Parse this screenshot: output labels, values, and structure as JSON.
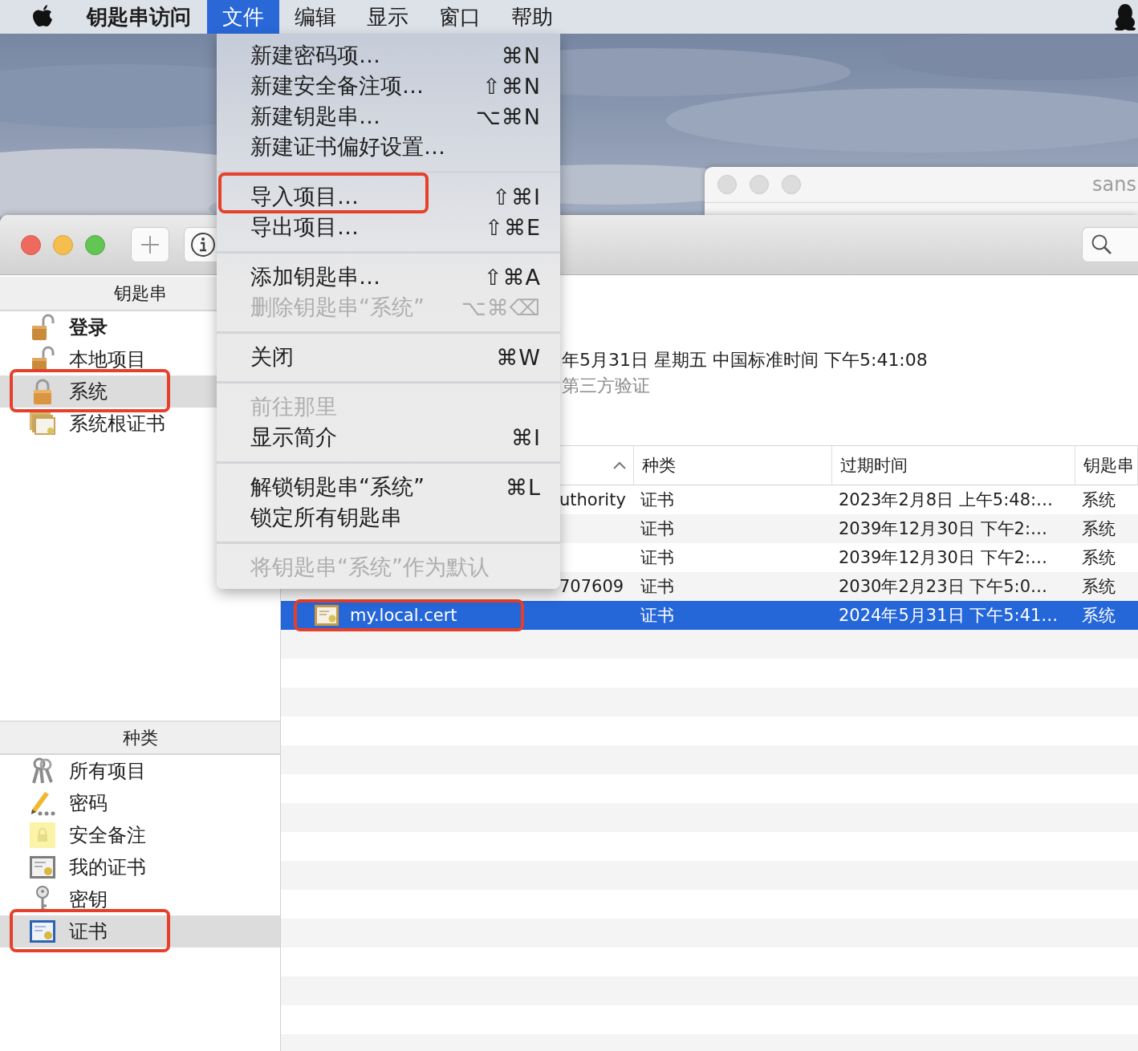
{
  "menubar": {
    "app_name": "钥匙串访问",
    "menus": [
      {
        "label": "文件",
        "selected": true
      },
      {
        "label": "编辑",
        "selected": false
      },
      {
        "label": "显示",
        "selected": false
      },
      {
        "label": "窗口",
        "selected": false
      },
      {
        "label": "帮助",
        "selected": false
      }
    ]
  },
  "file_menu": {
    "groups": [
      {
        "items": [
          {
            "label": "新建密码项…",
            "shortcut": "⌘N",
            "disabled": false,
            "annotated": false
          },
          {
            "label": "新建安全备注项…",
            "shortcut": "⇧⌘N",
            "disabled": false,
            "annotated": false
          },
          {
            "label": "新建钥匙串…",
            "shortcut": "⌥⌘N",
            "disabled": false,
            "annotated": false
          },
          {
            "label": "新建证书偏好设置…",
            "disabled": false,
            "annotated": false
          }
        ]
      },
      {
        "items": [
          {
            "label": "导入项目…",
            "shortcut": "⇧⌘I",
            "disabled": false,
            "annotated": true
          },
          {
            "label": "导出项目…",
            "shortcut": "⇧⌘E",
            "disabled": false,
            "annotated": false
          }
        ]
      },
      {
        "items": [
          {
            "label": "添加钥匙串…",
            "shortcut": "⇧⌘A",
            "disabled": false,
            "annotated": false
          },
          {
            "label": "删除钥匙串“系统”",
            "shortcut": "⌥⌘⌫",
            "disabled": true,
            "annotated": false
          }
        ]
      },
      {
        "items": [
          {
            "label": "关闭",
            "shortcut": "⌘W",
            "disabled": false,
            "annotated": false
          }
        ]
      },
      {
        "items": [
          {
            "label": "前往那里",
            "disabled": true,
            "annotated": false
          },
          {
            "label": "显示简介",
            "shortcut": "⌘I",
            "disabled": false,
            "annotated": false
          }
        ]
      },
      {
        "items": [
          {
            "label": "解锁钥匙串“系统”",
            "shortcut": "⌘L",
            "disabled": false,
            "annotated": false
          },
          {
            "label": "锁定所有钥匙串",
            "disabled": false,
            "annotated": false
          }
        ]
      },
      {
        "items": [
          {
            "label": "将钥匙串“系统”作为默认",
            "disabled": true,
            "annotated": false
          }
        ]
      }
    ]
  },
  "back_window": {
    "title": "sans"
  },
  "keychain_window": {
    "sidebar": {
      "keychains": {
        "header": "钥匙串",
        "items": [
          {
            "label": "登录",
            "bold": true,
            "selected": false,
            "annotated": false
          },
          {
            "label": "本地项目",
            "bold": false,
            "selected": false,
            "annotated": false
          },
          {
            "label": "系统",
            "bold": false,
            "selected": true,
            "annotated": true
          },
          {
            "label": "系统根证书",
            "bold": false,
            "selected": false,
            "annotated": false
          }
        ]
      },
      "categories": {
        "header": "种类",
        "items": [
          {
            "label": "所有项目",
            "bold": false,
            "selected": false,
            "annotated": false
          },
          {
            "label": "密码",
            "bold": false,
            "selected": false,
            "annotated": false
          },
          {
            "label": "安全备注",
            "bold": false,
            "selected": false,
            "annotated": false
          },
          {
            "label": "我的证书",
            "bold": false,
            "selected": false,
            "annotated": false
          },
          {
            "label": "密钥",
            "bold": false,
            "selected": false,
            "annotated": false
          },
          {
            "label": "证书",
            "bold": false,
            "selected": true,
            "annotated": true
          }
        ]
      }
    },
    "details": {
      "lines": [
        {
          "text": "年5月31日 星期五 中国标准时间 下午5:41:08",
          "kind": "normal"
        },
        {
          "text": "第三方验证",
          "kind": "muted"
        }
      ]
    },
    "table": {
      "columns": [
        {
          "label": "种类"
        },
        {
          "label": "过期时间"
        },
        {
          "label": "钥匙串"
        }
      ],
      "rows": [
        {
          "name": "uthority",
          "icon": false,
          "type": "证书",
          "expires": "2023年2月8日 上午5:48:…",
          "keychain": "系统",
          "selected": false,
          "annotated": false
        },
        {
          "icon": false,
          "type": "证书",
          "expires": "2039年12月30日 下午2:…",
          "keychain": "系统",
          "selected": false,
          "annotated": false
        },
        {
          "icon": false,
          "type": "证书",
          "expires": "2039年12月30日 下午2:…",
          "keychain": "系统",
          "selected": false,
          "annotated": false
        },
        {
          "name": "707609",
          "icon": false,
          "type": "证书",
          "expires": "2030年2月23日 下午5:0…",
          "keychain": "系统",
          "selected": false,
          "annotated": false
        },
        {
          "name": "my.local.cert",
          "icon": true,
          "type": "证书",
          "expires": "2024年5月31日 下午5:41…",
          "keychain": "系统",
          "selected": true,
          "annotated": true
        }
      ]
    }
  }
}
